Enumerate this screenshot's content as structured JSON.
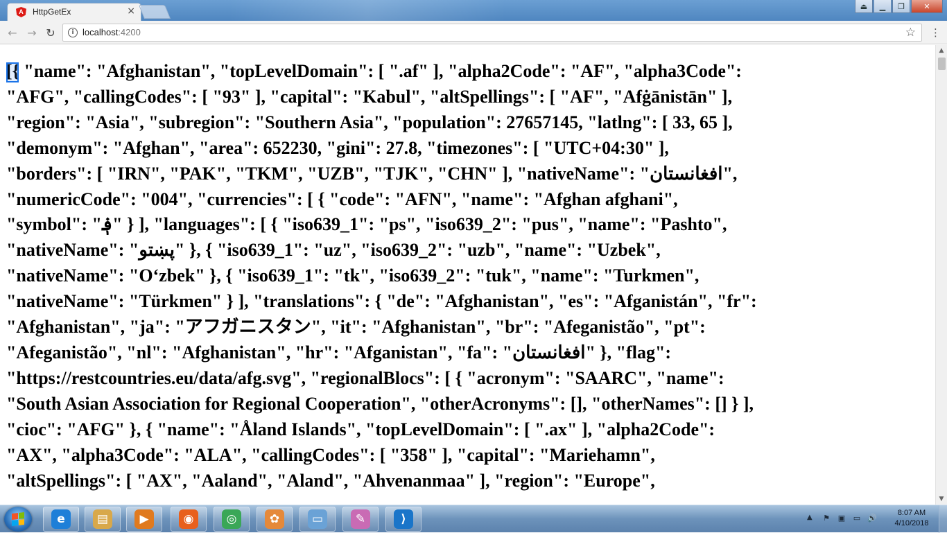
{
  "browser": {
    "tab_title": "HttpGetEx",
    "tab_close_glyph": "×",
    "favicon_letter": "A",
    "url_host": "localhost",
    "url_port": ":4200",
    "window_buttons": [
      "⏏",
      "▁",
      "❐",
      "✕"
    ]
  },
  "page": {
    "json_lines": [
      "[{ \"name\": \"Afghanistan\", \"topLevelDomain\": [ \".af\" ], \"alpha2Code\": \"AF\", \"alpha3Code\":",
      "\"AFG\", \"callingCodes\": [ \"93\" ], \"capital\": \"Kabul\", \"altSpellings\": [ \"AF\", \"Afġānistān\" ],",
      "\"region\": \"Asia\", \"subregion\": \"Southern Asia\", \"population\": 27657145, \"latlng\": [ 33, 65 ],",
      "\"demonym\": \"Afghan\", \"area\": 652230, \"gini\": 27.8, \"timezones\": [ \"UTC+04:30\" ],",
      "\"borders\": [ \"IRN\", \"PAK\", \"TKM\", \"UZB\", \"TJK\", \"CHN\" ], \"nativeName\": \"افغانستان\",",
      "\"numericCode\": \"004\", \"currencies\": [ { \"code\": \"AFN\", \"name\": \"Afghan afghani\",",
      "\"symbol\": \"؋\" } ], \"languages\": [ { \"iso639_1\": \"ps\", \"iso639_2\": \"pus\", \"name\": \"Pashto\",",
      "\"nativeName\": \"پښتو\" }, { \"iso639_1\": \"uz\", \"iso639_2\": \"uzb\", \"name\": \"Uzbek\",",
      "\"nativeName\": \"Oʻzbek\" }, { \"iso639_1\": \"tk\", \"iso639_2\": \"tuk\", \"name\": \"Turkmen\",",
      "\"nativeName\": \"Türkmen\" } ], \"translations\": { \"de\": \"Afghanistan\", \"es\": \"Afganistán\", \"fr\":",
      "\"Afghanistan\", \"ja\": \"アフガニスタン\", \"it\": \"Afghanistan\", \"br\": \"Afeganistão\", \"pt\":",
      "\"Afeganistão\", \"nl\": \"Afghanistan\", \"hr\": \"Afganistan\", \"fa\": \"افغانستان\" }, \"flag\":",
      "\"https://restcountries.eu/data/afg.svg\", \"regionalBlocs\": [ { \"acronym\": \"SAARC\", \"name\":",
      "\"South Asian Association for Regional Cooperation\", \"otherAcronyms\": [], \"otherNames\": [] } ],",
      "\"cioc\": \"AFG\" }, { \"name\": \"Åland Islands\", \"topLevelDomain\": [ \".ax\" ], \"alpha2Code\":",
      "\"AX\", \"alpha3Code\": \"ALA\", \"callingCodes\": [ \"358\" ], \"capital\": \"Mariehamn\",",
      "\"altSpellings\": [ \"AX\", \"Aaland\", \"Aland\", \"Ahvenanmaa\" ], \"region\": \"Europe\","
    ]
  },
  "taskbar": {
    "apps": [
      {
        "name": "internet-explorer",
        "glyph": "e",
        "color": "#1e7fd8"
      },
      {
        "name": "file-explorer",
        "glyph": "▤",
        "color": "#d8a84a"
      },
      {
        "name": "media-player",
        "glyph": "▶",
        "color": "#e07a1f"
      },
      {
        "name": "firefox",
        "glyph": "◉",
        "color": "#e8601c"
      },
      {
        "name": "chrome",
        "glyph": "◎",
        "color": "#3aa757"
      },
      {
        "name": "flower-app",
        "glyph": "✿",
        "color": "#e5893a"
      },
      {
        "name": "notepad-app",
        "glyph": "▭",
        "color": "#6aa2d6"
      },
      {
        "name": "paint",
        "glyph": "✎",
        "color": "#c96bb4"
      },
      {
        "name": "visual-studio-code",
        "glyph": "⟩",
        "color": "#1a75c9"
      }
    ],
    "tray_icons": [
      "▲",
      "⚑",
      "▣",
      "▭",
      "🔊"
    ],
    "clock_time": "8:07 AM",
    "clock_date": "4/10/2018"
  }
}
